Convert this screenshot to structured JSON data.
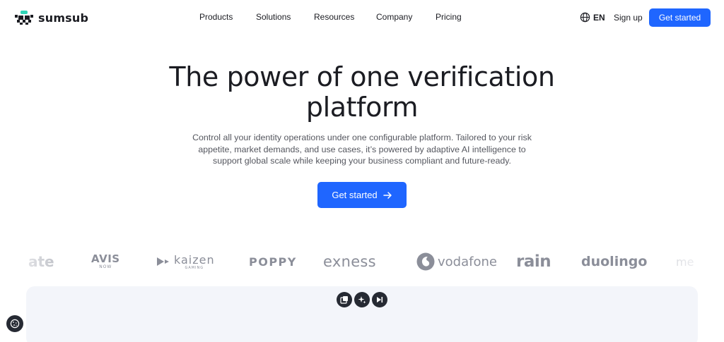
{
  "brand": {
    "name": "sumsub",
    "accent": "#1f66ff"
  },
  "nav": {
    "items": [
      {
        "label": "Products"
      },
      {
        "label": "Solutions"
      },
      {
        "label": "Resources"
      },
      {
        "label": "Company"
      },
      {
        "label": "Pricing"
      }
    ]
  },
  "header": {
    "language": "EN",
    "signup_label": "Sign up",
    "cta_label": "Get started"
  },
  "hero": {
    "title_line1": "The power of one verification",
    "title_line2": "platform",
    "subtitle_line1": "Control all your identity operations under one configurable platform. Tailored to your risk",
    "subtitle_line2": "appetite, market demands, and use cases, it’s powered by adaptive AI intelligence to",
    "subtitle_line3": "support global scale while keeping your business compliant and future-ready.",
    "cta_label": "Get started"
  },
  "logos": {
    "partial_left": "ate",
    "avis": "AVIS",
    "avis_sub": "NOW",
    "kaizen": "kaizen",
    "kaizen_sub": "GAMING",
    "poppy": "POPPY",
    "exness": "exness",
    "vodafone": "vodafone",
    "rain": "rain",
    "duolingo": "duolingo",
    "partial_right": "me"
  },
  "icons": {
    "language": "globe-icon",
    "hero_cta": "arrow-right-icon",
    "panel_controls": [
      "picture-in-picture-icon",
      "sparkle-icon",
      "skip-forward-icon"
    ],
    "cookie": "cookie-icon"
  }
}
